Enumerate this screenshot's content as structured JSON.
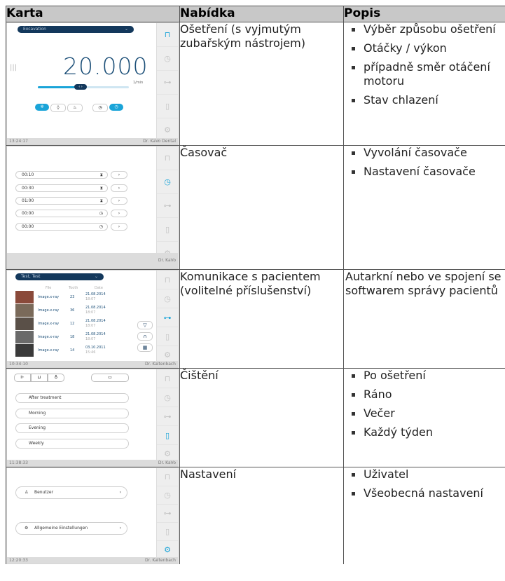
{
  "headers": {
    "col1": "Karta",
    "col2": "Nabídka",
    "col3": "Popis"
  },
  "rows": [
    {
      "menu": "Ošetření (s vyjmutým zubařským nástrojem)",
      "desc": [
        "Výběr způsobu ošetření",
        "Otáčky / výkon",
        "případně směr otáčení motoru",
        "Stav chlazení"
      ],
      "screen": {
        "dropdown": "Excavation",
        "value": "20.000",
        "unit": "1/min",
        "footer_left": "13:24:17",
        "footer_right": "Dr. KaVo Dental"
      }
    },
    {
      "menu": "Časovač",
      "desc": [
        "Vyvolání časovače",
        "Nastavení časovače"
      ],
      "screen": {
        "timers": [
          "00:10",
          "00:30",
          "01:00",
          "00:00",
          "00:00"
        ],
        "footer_left": "",
        "footer_right": "Dr. KaVo"
      }
    },
    {
      "menu": "Komunikace s pacientem (volitelné příslušenství)",
      "desc_text": "Autarkní nebo ve spojení se softwarem správy pacientů",
      "screen": {
        "dropdown": "Test, Test",
        "col_headers": [
          "File",
          "Tooth",
          "Date"
        ],
        "files": [
          {
            "name": "Image.x-ray",
            "tooth": "23",
            "date": "21.08.2014",
            "time": "18:07"
          },
          {
            "name": "Image.x-ray",
            "tooth": "36",
            "date": "21.08.2014",
            "time": "18:07"
          },
          {
            "name": "Image.x-ray",
            "tooth": "12",
            "date": "21.08.2014",
            "time": "18:07"
          },
          {
            "name": "Image.x-ray",
            "tooth": "18",
            "date": "21.08.2014",
            "time": "18:07"
          },
          {
            "name": "Image.x-ray",
            "tooth": "14",
            "date": "03.10.2011",
            "time": "15:46"
          }
        ],
        "footer_left": "10:34:10",
        "footer_right": "Dr. Kaltenbach"
      }
    },
    {
      "menu": "Čištění",
      "desc": [
        "Po ošetření",
        "Ráno",
        "Večer",
        "Každý týden"
      ],
      "screen": {
        "items": [
          "After treatment",
          "Morning",
          "Evening",
          "Weekly"
        ],
        "footer_left": "11:38:33",
        "footer_right": "Dr. KaVo"
      }
    },
    {
      "menu": "Nastavení",
      "desc": [
        "Uživatel",
        "Všeobecná nastavení"
      ],
      "screen": {
        "items": [
          "Benutzer",
          "Allgemeine Einstellungen"
        ],
        "footer_left": "12:20:33",
        "footer_right": "Dr. Kaltenbach"
      }
    }
  ],
  "colors": {
    "accent": "#1aa4d8",
    "dark_blue": "#13385c",
    "header_bg": "#c8c8c8"
  }
}
